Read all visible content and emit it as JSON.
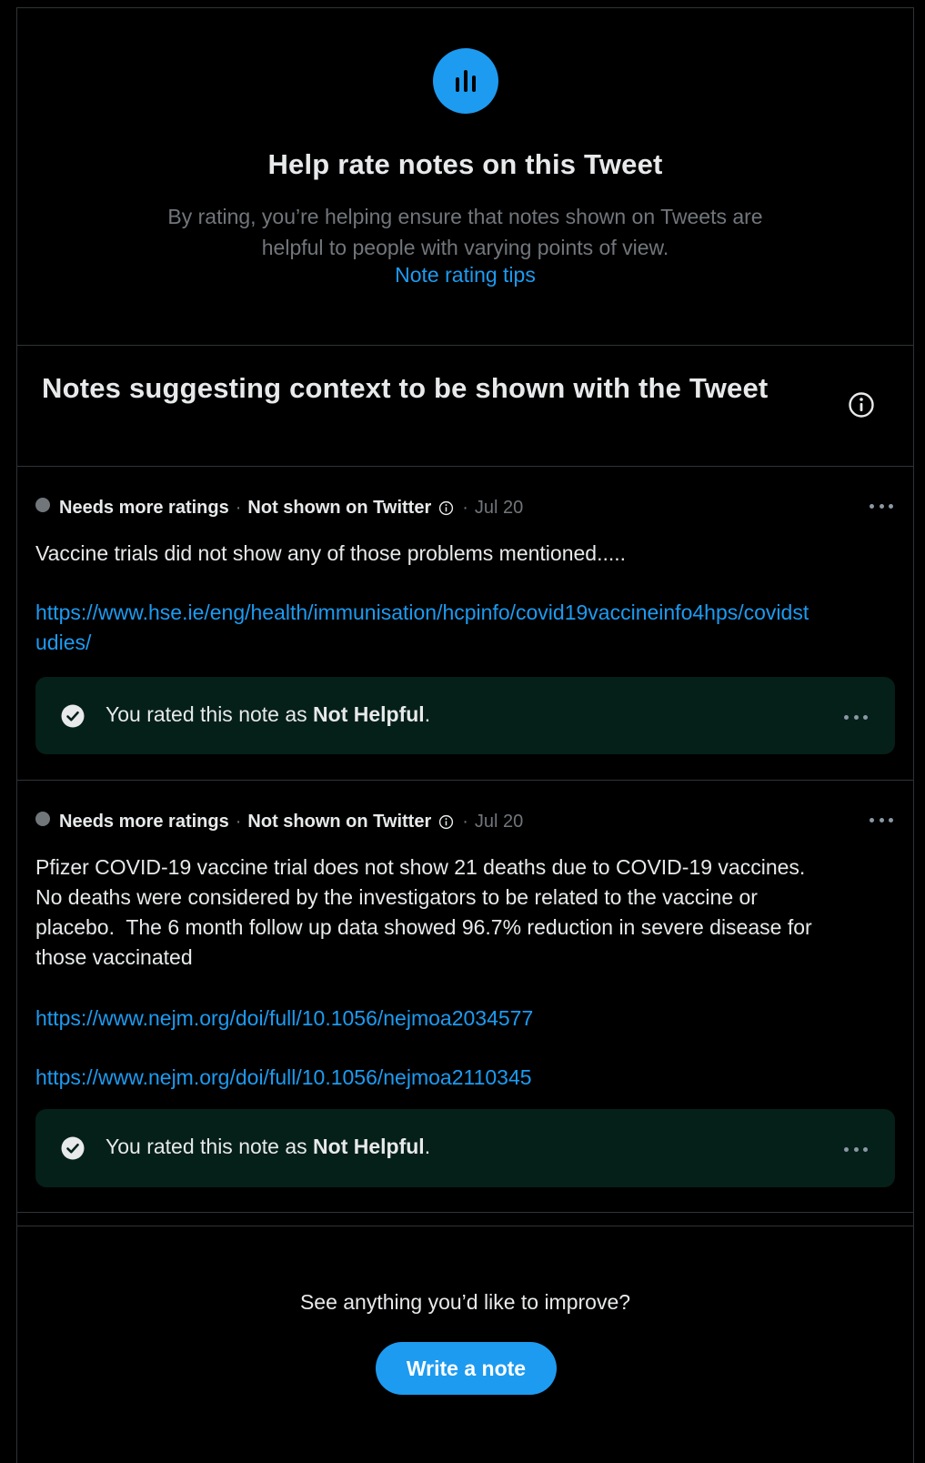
{
  "hero": {
    "title": "Help rate notes on this Tweet",
    "subtitle": "By rating, you’re helping ensure that notes shown on Tweets are helpful to people with varying points of view.",
    "link": "Note rating tips",
    "icon": "chart-bars-icon",
    "accent": "#1d9bf0"
  },
  "section": {
    "title": "Notes suggesting context to be shown with the Tweet",
    "info_icon": "info-icon"
  },
  "notes": [
    {
      "status": "Needs more ratings",
      "visibility": "Not shown on Twitter",
      "date": "Jul 20",
      "body": "Vaccine trials did not show any of those problems mentioned.....",
      "links": [
        "https://www.hse.ie/eng/health/immunisation/hcpinfo/covid19vaccineinfo4hps/covidstudies/"
      ],
      "rating_prefix": "You rated this note as ",
      "rating_value": "Not Helpful",
      "rating_suffix": "."
    },
    {
      "status": "Needs more ratings",
      "visibility": "Not shown on Twitter",
      "date": "Jul 20",
      "body": "Pfizer COVID-19 vaccine trial does not show 21 deaths due to COVID-19 vaccines.  No deaths were considered by the investigators to be related to the vaccine or placebo.  The 6 month follow up data showed 96.7% reduction in severe disease for those vaccinated",
      "links": [
        "https://www.nejm.org/doi/full/10.1056/nejmoa2034577",
        "https://www.nejm.org/doi/full/10.1056/nejmoa2110345"
      ],
      "rating_prefix": "You rated this note as ",
      "rating_value": "Not Helpful",
      "rating_suffix": "."
    }
  ],
  "footer": {
    "question": "See anything you’d like to improve?",
    "button": "Write a note"
  },
  "separator": "·"
}
